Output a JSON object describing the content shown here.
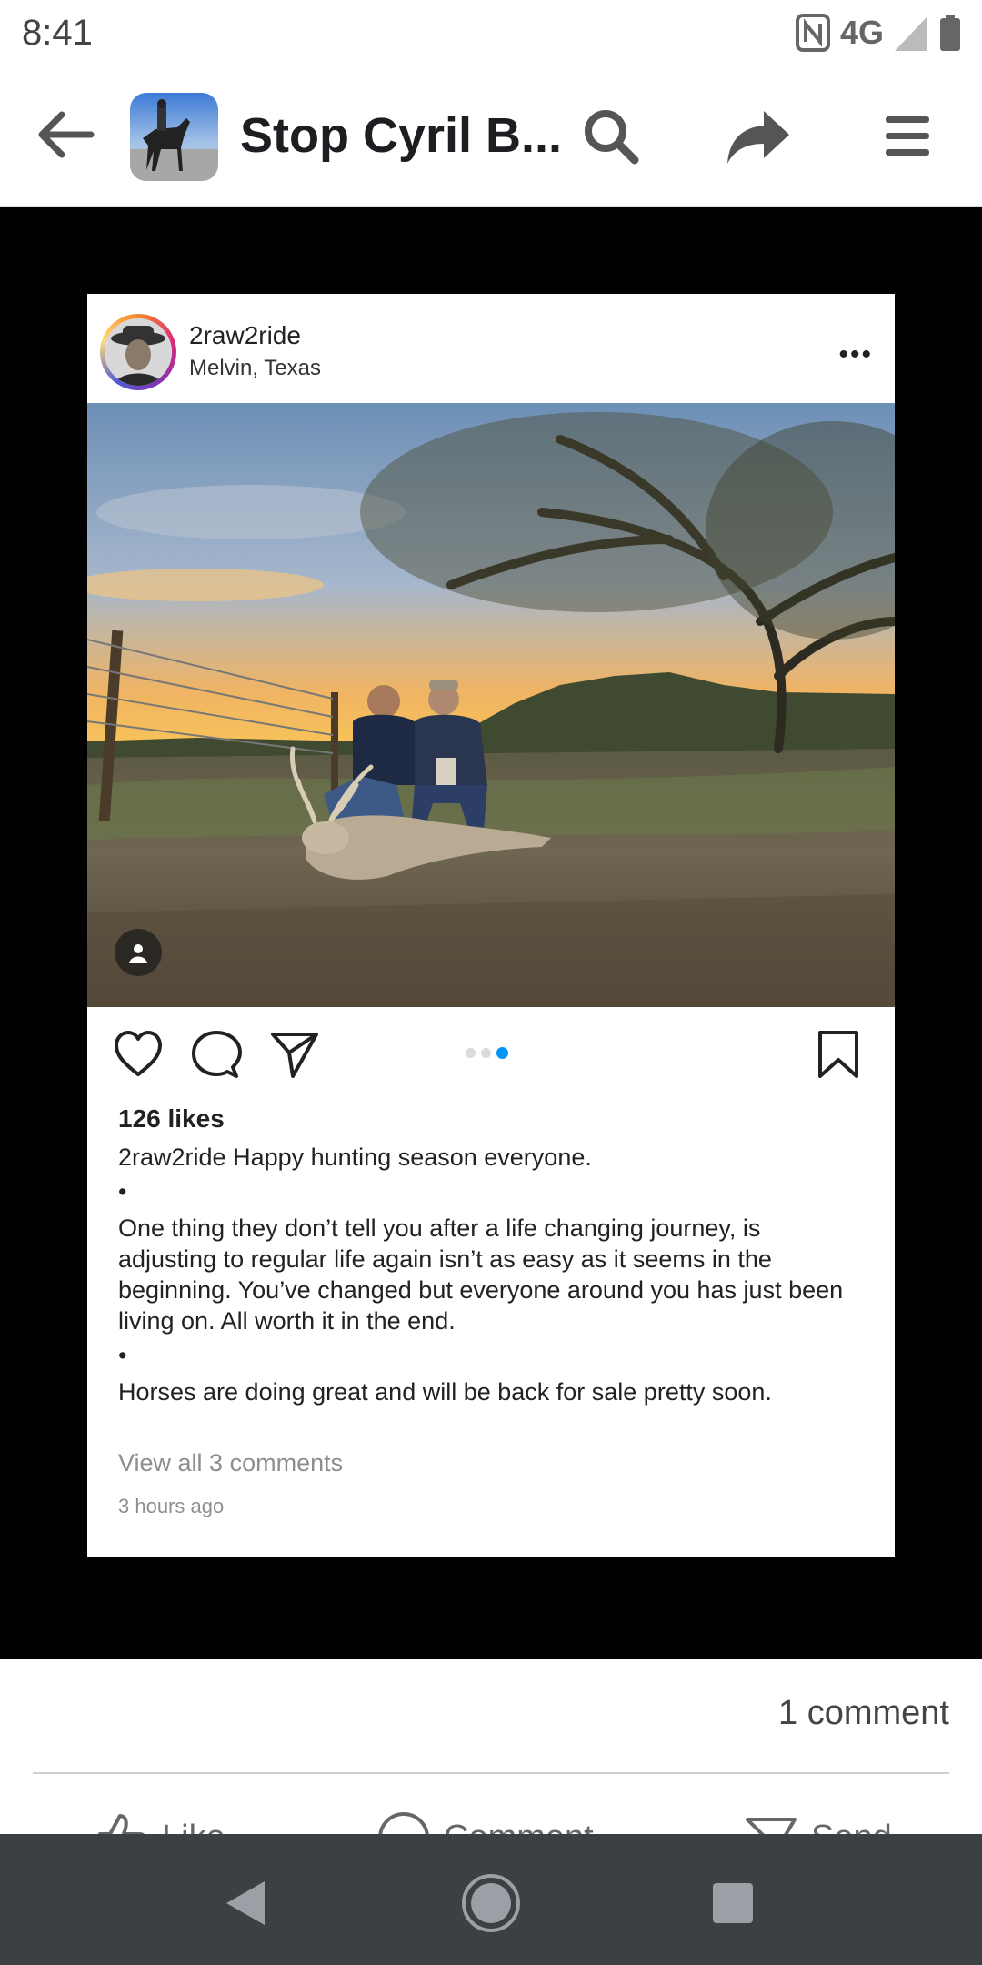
{
  "status_bar": {
    "time": "8:41",
    "network": "4G"
  },
  "header": {
    "title": "Stop Cyril B..."
  },
  "post": {
    "username": "2raw2ride",
    "location": "Melvin, Texas",
    "more": "•••",
    "likes": "126 likes",
    "caption_user": "2raw2ride",
    "caption_text": "Happy hunting season everyone.",
    "separator": "•",
    "paragraph1": "One thing they don’t tell you after a life changing journey, is adjusting to regular life again isn’t as easy as it seems in the beginning. You’ve changed but everyone around you has just been living on. All worth it in the end.",
    "paragraph2": "Horses are doing great and will be back for sale pretty soon.",
    "view_comments": "View all 3 comments",
    "time_ago": "3 hours ago",
    "carousel": {
      "count": 3,
      "active": 3
    }
  },
  "footer": {
    "comment_count": "1 comment",
    "like_label": "Like",
    "comment_label": "Comment",
    "send_label": "Send"
  },
  "colors": {
    "nav_bar": "#3c4043",
    "media_bg": "#000000",
    "accent_dot": "#0095f6"
  }
}
